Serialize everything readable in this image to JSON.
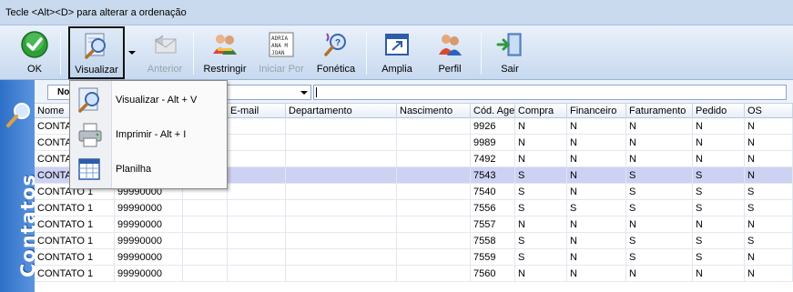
{
  "title": "Tecle <Alt><D> para alterar a ordenação",
  "toolbar": {
    "ok": "OK",
    "visualizar": "Visualizar",
    "anterior": "Anterior",
    "restringir": "Restringir",
    "iniciar_por": "Iniciar Por",
    "fonetica": "Fonética",
    "amplia": "Amplia",
    "perfil": "Perfil",
    "sair": "Sair",
    "iniciar_icon_text": "ADRIA\nANA M\nJOAN"
  },
  "side_label": "Contatos",
  "filter": {
    "left_combo": "No",
    "search_value": ""
  },
  "menu": {
    "items": [
      {
        "label": "Visualizar - Alt + V"
      },
      {
        "label": "Imprimir - Alt + I"
      },
      {
        "label": "Planilha"
      }
    ]
  },
  "table": {
    "columns": [
      "Nome",
      "",
      "",
      "E-mail",
      "Departamento",
      "Nascimento",
      "Cód. Age",
      "Compra",
      "Financeiro",
      "Faturamento",
      "Pedido",
      "OS"
    ],
    "rows": [
      [
        "CONTATO",
        "",
        "",
        "",
        "",
        "",
        "9926",
        "N",
        "N",
        "N",
        "N",
        "N"
      ],
      [
        "CONTATO",
        "",
        "",
        "",
        "",
        "",
        "9989",
        "N",
        "N",
        "N",
        "N",
        "N"
      ],
      [
        "CONTATO",
        "",
        "",
        "",
        "",
        "",
        "7492",
        "N",
        "N",
        "N",
        "N",
        "N"
      ],
      [
        "CONTATO",
        "",
        "",
        "",
        "",
        "",
        "7543",
        "S",
        "N",
        "S",
        "S",
        "N"
      ],
      [
        "CONTATO 1",
        "99990000",
        "",
        "",
        "",
        "",
        "7540",
        "S",
        "N",
        "S",
        "S",
        "S"
      ],
      [
        "CONTATO 1",
        "99990000",
        "",
        "",
        "",
        "",
        "7556",
        "S",
        "S",
        "S",
        "S",
        "S"
      ],
      [
        "CONTATO 1",
        "99990000",
        "",
        "",
        "",
        "",
        "7557",
        "N",
        "N",
        "N",
        "N",
        "N"
      ],
      [
        "CONTATO 1",
        "99990000",
        "",
        "",
        "",
        "",
        "7558",
        "S",
        "N",
        "S",
        "S",
        "S"
      ],
      [
        "CONTATO 1",
        "99990000",
        "",
        "",
        "",
        "",
        "7559",
        "S",
        "N",
        "S",
        "S",
        "N"
      ],
      [
        "CONTATO 1",
        "99990000",
        "",
        "",
        "",
        "",
        "7560",
        "N",
        "N",
        "N",
        "N",
        "N"
      ]
    ],
    "selected_row": 3
  },
  "colors": {
    "selected_row": "#cdd1f2",
    "side_panel": "#2e6fc7"
  }
}
